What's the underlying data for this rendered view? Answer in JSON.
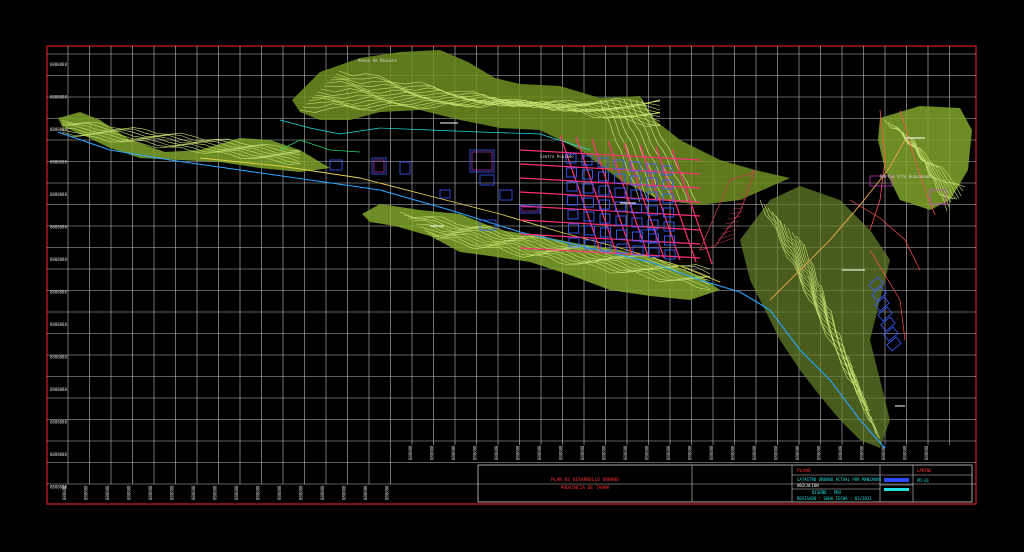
{
  "colors": {
    "background": "#000000",
    "grid": "#bfbfbf",
    "frame": "#d21d1d",
    "terrain": "#9bc23c",
    "contour": "#c8e070",
    "streets": "#ff2f7a",
    "blocks": "#3a5cff",
    "river": "#2aa4ff",
    "road": "#e4d04b",
    "cyan": "#20e0e0",
    "white": "#ffffff",
    "red_text": "#ff3030"
  },
  "grid": {
    "y_ticks": [
      "8888888",
      "8888888",
      "8888888",
      "8888888",
      "8888888",
      "8888888",
      "8888888",
      "8888888",
      "8888888",
      "8888888",
      "8888888",
      "8888888",
      "8888888",
      "8888888"
    ],
    "x_ticks_lower": [
      "888888",
      "888888",
      "888888",
      "888888",
      "888888",
      "888888",
      "888888",
      "888888",
      "888888",
      "888888",
      "888888",
      "888888",
      "888888",
      "888888",
      "888888",
      "888888"
    ],
    "x_ticks_upper": [
      "888888",
      "888888",
      "888888",
      "888888",
      "888888",
      "888888",
      "888888",
      "888888",
      "888888",
      "888888",
      "888888",
      "888888",
      "888888",
      "888888",
      "888888",
      "888888",
      "888888",
      "888888",
      "888888",
      "888888",
      "888888",
      "888888",
      "888888",
      "888888",
      "888888"
    ]
  },
  "annotations": {
    "top_label": "Anexo de Paucara",
    "mid_label": "Centro Poblado",
    "right_label": "Barrio Alto Huasahuasi"
  },
  "title_block": {
    "project_title": "PLAN DE DESARROLLO URBANO",
    "project_subtitle": "PROVINCIA DE TARMA",
    "sheet_label": "PLANO",
    "sheet_title": "CATASTRO URBANO ACTUAL POR MANZANAS",
    "location_label": "UBICACION",
    "scale_line": "DISEÑO : PDU",
    "date_line": "REVISADO : SAHA      FECHA : 03/2021",
    "sheet_code": "LAMINA",
    "sheet_number": "PD-01"
  }
}
